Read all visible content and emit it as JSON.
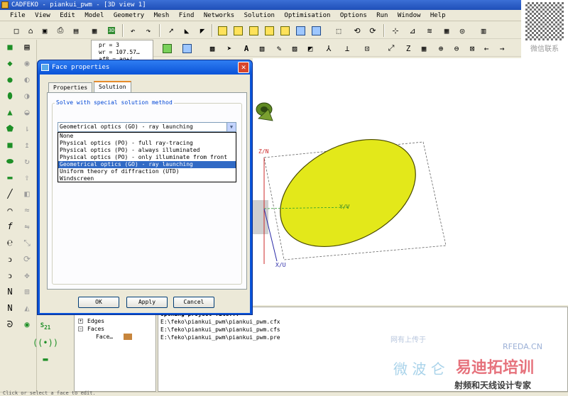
{
  "window": {
    "title": "CADFEKO - piankui_pwm - [3D view 1]"
  },
  "menu": [
    "File",
    "View",
    "Edit",
    "Model",
    "Geometry",
    "Mesh",
    "Find",
    "Networks",
    "Solution",
    "Optimisation",
    "Options",
    "Run",
    "Window",
    "Help"
  ],
  "info_panel": {
    "lines": [
      "pr = 3",
      "wr = 107.57…",
      "af8 = ag+(…"
    ]
  },
  "dialog": {
    "title": "Face properties",
    "close_glyph": "✕",
    "tabs": [
      "Properties",
      "Solution"
    ],
    "active_tab": "Solution",
    "group_label": "Solve with special solution method",
    "selected_value": "Geometrical optics (GO) - ray launching",
    "options": [
      "None",
      "Physical optics (PO) - full ray-tracing",
      "Physical optics (PO) - always illuminated",
      "Physical optics (PO) - only illuminate from front",
      "Geometrical optics (GO) - ray launching",
      "Uniform theory of diffraction (UTD)",
      "Windscreen"
    ],
    "highlighted_option_index": 4,
    "buttons": {
      "ok": "OK",
      "apply": "Apply",
      "cancel": "Cancel"
    }
  },
  "view": {
    "axis_z": "Z/N",
    "axis_y": "Y/V",
    "axis_x": "X/U",
    "colors": {
      "ellipse_fill": "#e3e81a",
      "ellipse_edge": "#4a4a00",
      "horn": "#6a8a2a",
      "axis": "#2a2aa8",
      "axis_z": "#cc2a2a"
    }
  },
  "tree": {
    "items": [
      {
        "label": "Edges",
        "expander": "+"
      },
      {
        "label": "Faces",
        "expander": "−"
      },
      {
        "label": "Face…",
        "expander": ""
      }
    ]
  },
  "output": {
    "lines": [
      "Opening project file...",
      "E:\\feko\\piankui_pwm\\piankui_pwm.cfx",
      "E:\\feko\\piankui_pwm\\piankui_pwm.cfs",
      "E:\\feko\\piankui_pwm\\piankui_pwm.pre"
    ]
  },
  "status": {
    "text": "Click or select a face to edit."
  },
  "watermarks": {
    "top_right": "微信联系",
    "site": "RFEDA.CN",
    "brand": "易迪拓培训",
    "slogan": "射频和天线设计专家",
    "faded_a": "网有上传于",
    "faded_b": "微 波 仑"
  }
}
